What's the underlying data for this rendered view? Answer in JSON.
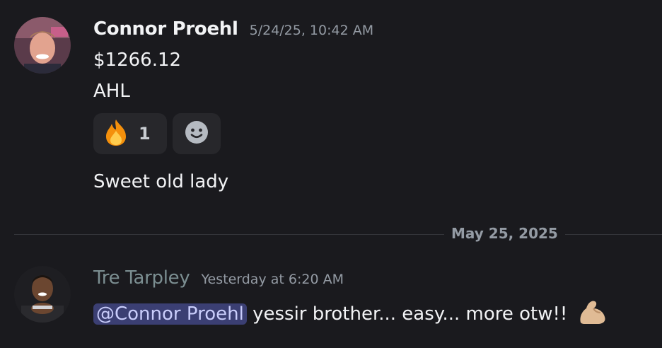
{
  "messages": [
    {
      "author": "Connor Proehl",
      "author_color": "#f2f3f5",
      "timestamp": "5/24/25, 10:42 AM",
      "lines": [
        "$1266.12",
        "AHL"
      ],
      "reactions": [
        {
          "emoji": "fire-icon",
          "count": "1"
        }
      ],
      "add_reaction_icon": "smiley-icon",
      "followup": "Sweet old lady"
    },
    {
      "author": "Tre Tarpley",
      "author_color": "#7b8e91",
      "timestamp": "Yesterday at 6:20 AM",
      "mention": "@Connor Proehl",
      "text": " yessir brother... easy... more otw!! ",
      "trailing_emoji": "flexed-biceps-icon"
    }
  ],
  "date_divider": "May 25, 2025",
  "colors": {
    "background": "#1a1a1e",
    "mention_bg": "#3b3f73",
    "mention_text": "#c9cdfb",
    "timestamp": "#949ba4"
  }
}
